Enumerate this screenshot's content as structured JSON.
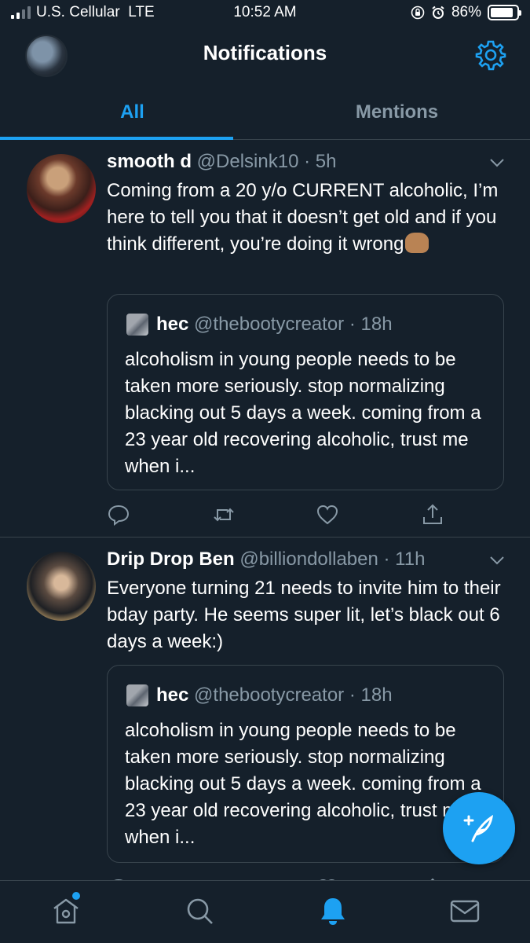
{
  "status_bar": {
    "carrier": "U.S. Cellular",
    "network": "LTE",
    "time": "10:52 AM",
    "battery": "86%",
    "battery_level": 0.86
  },
  "header": {
    "title": "Notifications"
  },
  "tabs": [
    {
      "label": "All",
      "active": true
    },
    {
      "label": "Mentions",
      "active": false
    }
  ],
  "tweets": [
    {
      "name": "smooth d",
      "meta": "@Delsink10 · 5h",
      "text": "Coming from a 20 y/o CURRENT alcoholic, I’m here to tell you that it doesn’t get old and if you think different, you’re doing it wrong",
      "quote": {
        "name": "hec",
        "meta": "@thebootycreator · 18h",
        "text": "alcoholism in young people needs to be taken more seriously. stop normalizing blacking out 5 days a week. coming from a 23 year old recovering alcoholic, trust me when i..."
      }
    },
    {
      "name": "Drip Drop Ben",
      "meta": "@billiondollaben · 11h",
      "text": "Everyone turning 21 needs to invite him to their bday party. He seems super lit,  let’s black out 6 days a week:)",
      "quote": {
        "name": "hec",
        "meta": "@thebootycreator · 18h",
        "text": "alcoholism in young people needs to be taken more seriously. stop normalizing blacking out 5 days a week. coming from a 23 year old recovering alcoholic, trust me when i..."
      }
    }
  ],
  "icons": {
    "settings": "gear-icon",
    "reply": "reply-icon",
    "retweet": "retweet-icon",
    "like": "heart-icon",
    "share": "share-icon",
    "compose": "compose-tweet-icon",
    "nav": [
      "home-icon",
      "search-icon",
      "notifications-bell-icon",
      "messages-icon"
    ]
  },
  "colors": {
    "background": "#15202b",
    "accent": "#1da1f2",
    "secondary_text": "#8899a6",
    "divider": "#38444d"
  }
}
